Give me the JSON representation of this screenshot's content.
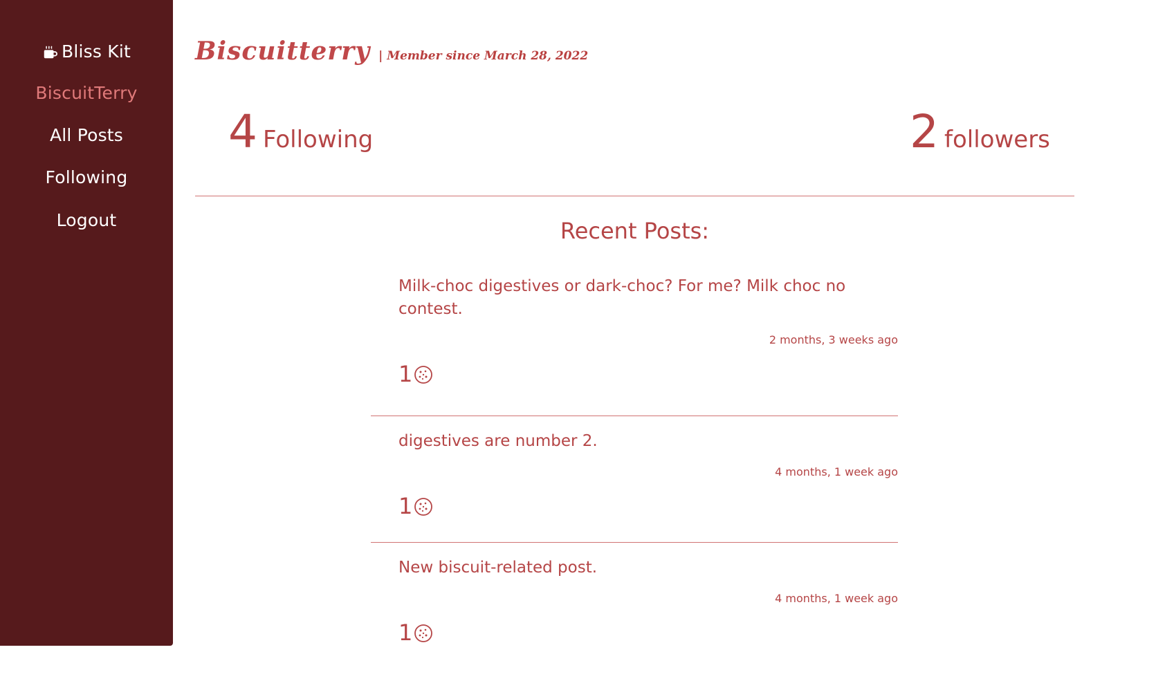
{
  "sidebar": {
    "brand": "Bliss Kit",
    "brand_icon": "coffee-cup-icon",
    "items": [
      {
        "label": "BiscuitTerry",
        "active": true
      },
      {
        "label": "All Posts",
        "active": false
      },
      {
        "label": "Following",
        "active": false
      },
      {
        "label": "Logout",
        "active": false
      }
    ]
  },
  "profile": {
    "username": "Biscuitterry",
    "member_since": "| Member since March 28, 2022",
    "following_count": "4",
    "following_label": "Following",
    "followers_count": "2",
    "followers_label": "followers"
  },
  "recent_posts": {
    "title": "Recent Posts:",
    "posts": [
      {
        "text": "Milk-choc digestives or dark-choc? For me? Milk choc no contest.",
        "time": "2 months, 3 weeks ago",
        "likes": "1"
      },
      {
        "text": "digestives are number 2.",
        "time": "4 months, 1 week ago",
        "likes": "1"
      },
      {
        "text": "New biscuit-related post.",
        "time": "4 months, 1 week ago",
        "likes": "1"
      }
    ]
  },
  "colors": {
    "sidebar_bg": "#561a1c",
    "accent": "#b54546",
    "active_nav": "#e07a7a"
  }
}
